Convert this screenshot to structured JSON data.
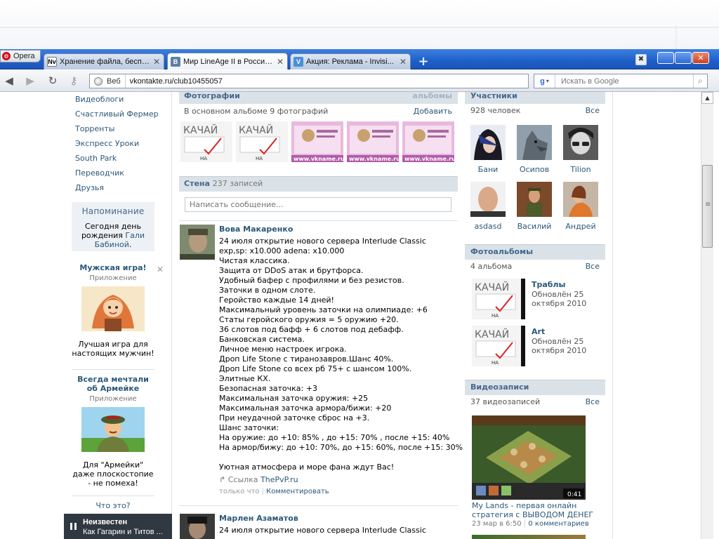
{
  "browser": {
    "opera_label": "Opera",
    "tabs": [
      {
        "title": "Хранение файла, беспл...",
        "favicon": "Nv"
      },
      {
        "title": "Мир LineAge II в России...",
        "favicon": "B"
      },
      {
        "title": "Акция: Реклама - Invisi...",
        "favicon": "V"
      }
    ],
    "address": {
      "web_label": "Веб",
      "url": "vkontakte.ru/club10455057"
    },
    "search": {
      "placeholder": "Искать в Google"
    }
  },
  "left": {
    "nav": [
      "Видеоблоги",
      "Счастливый Фермер",
      "Торренты",
      "Экспресс Уроки",
      "South Park",
      "Переводчик",
      "Друзья"
    ],
    "reminder": {
      "title": "Напоминание",
      "text_pre": "Сегодня день рождения",
      "link": "Гали Бабиной",
      "text_post": "."
    },
    "ad1": {
      "title": "Мужская игра!",
      "sub": "Приложение",
      "desc": "Лучшая игра для настоящих мужчин!"
    },
    "ad2": {
      "title": "Всегда мечтали об Армейке",
      "sub": "Приложение",
      "desc": "Для \"Армейки\" даже плоскостопие - не помеха!"
    },
    "what": "Что это?",
    "player": {
      "artist": "Неизвестен",
      "track": "Как Гагарин и Титов ..."
    }
  },
  "photos": {
    "header": "Фотографии",
    "right": "альбомы",
    "sub": "В основном альбоме 9 фотографий",
    "add": "Добавить"
  },
  "wall": {
    "header": "Стена",
    "count": "237 записей",
    "placeholder": "Написать сообщение..."
  },
  "post1": {
    "author": "Вова Макаренко",
    "lines": [
      "24 июля открытие нового сервера Interlude Classic",
      "exp,sp: x10.000 adena: x10.000",
      "Чистая классика.",
      "Защита от DDoS атак и брутфорса.",
      "Удобный бафер с профилями и без резистов.",
      "Заточки в одном слоте.",
      "Геройство каждые 14 дней!",
      "Максимальный уровень заточки на олимпиаде: +6",
      "Статы геройского оружия = 5 оружию +20.",
      "36 слотов под бафф + 6 слотов под дебафф.",
      "Банковская система.",
      "Личное меню настроек игрока.",
      "Дроп Life Stone с тиранозавров.Шанс 40%.",
      "Дроп Life Stone со всех рб 75+ с шансом 100%.",
      "Элитные КХ.",
      "Безопасная заточка: +3",
      "Максимальная заточка оружия: +25",
      "Максимальная заточка армора/бижи: +20",
      "При неудачной заточке сброс на +3.",
      "Шанс заточки:",
      "На оружие: до +10: 85% , до +15: 70% , после +15: 40%",
      "На армор/бижу: до +10: 70%, до +15: 60%, после +15: 30%"
    ],
    "closing": "Уютная атмосфера и море фана ждут Вас!",
    "link_label": "Ссылка",
    "link": "ThePvP.ru",
    "time": "только что",
    "comment": "Комментировать"
  },
  "post2": {
    "author": "Марлен Азаматов",
    "lines": [
      "24 июля открытие нового сервера Interlude Classic"
    ]
  },
  "members": {
    "header": "Участники",
    "count": "928 человек",
    "all": "Все",
    "list": [
      "Бани",
      "Осипов",
      "Tilion",
      "asdasd",
      "Василий",
      "Андрей"
    ]
  },
  "albums": {
    "header": "Фотоальбомы",
    "count": "4 альбома",
    "all": "Все",
    "list": [
      {
        "title": "Траблы",
        "updated": "Обновлён 25 октября 2010"
      },
      {
        "title": "Art",
        "updated": "Обновлён 25 октября 2010"
      }
    ]
  },
  "videos": {
    "header": "Видеозаписи",
    "count": "37 видеозаписей",
    "all": "Все",
    "duration": "0:41",
    "title": "My Lands - первая онлайн стратегия с ВЫВОДОМ ДЕНЕГ",
    "date": "23 мар в 6:50",
    "comments": "0 комментариев"
  },
  "thumb_text": {
    "kachai": "КАЧАЙ",
    "na": "НА",
    "vkname": "www.vkname.ru"
  },
  "colors": {
    "link": "#2b587a",
    "header_bg": "#dae2e8",
    "header_text": "#45688e",
    "titlebar": "#1f5fc8"
  }
}
